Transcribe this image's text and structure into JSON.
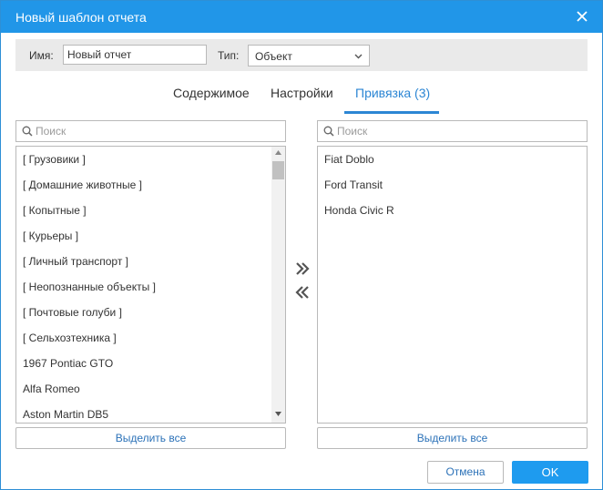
{
  "dialog": {
    "title": "Новый шаблон отчета",
    "close_icon": "close-icon"
  },
  "form": {
    "name_label": "Имя:",
    "name_value": "Новый отчет",
    "type_label": "Тип:",
    "type_value": "Объект"
  },
  "tabs": [
    {
      "label": "Содержимое",
      "active": false
    },
    {
      "label": "Настройки",
      "active": false
    },
    {
      "label": "Привязка (3)",
      "active": true
    }
  ],
  "left_panel": {
    "search_placeholder": "Поиск",
    "items": [
      "[ Грузовики ]",
      "[ Домашние животные ]",
      "[ Копытные ]",
      "[ Курьеры ]",
      "[ Личный транспорт ]",
      "[ Неопознанные объекты ]",
      "[ Почтовые голуби ]",
      "[ Сельхозтехника ]",
      "1967 Pontiac GTO",
      "Alfa Romeo",
      "Aston Martin DB5"
    ],
    "select_all": "Выделить все"
  },
  "right_panel": {
    "search_placeholder": "Поиск",
    "items": [
      "Fiat Doblo",
      "Ford Transit",
      "Honda Civic R"
    ],
    "select_all": "Выделить все"
  },
  "footer": {
    "cancel": "Отмена",
    "ok": "OK"
  },
  "colors": {
    "titlebar": "#2196e8",
    "accent": "#2c86d4",
    "ok_button": "#1e9bef"
  }
}
